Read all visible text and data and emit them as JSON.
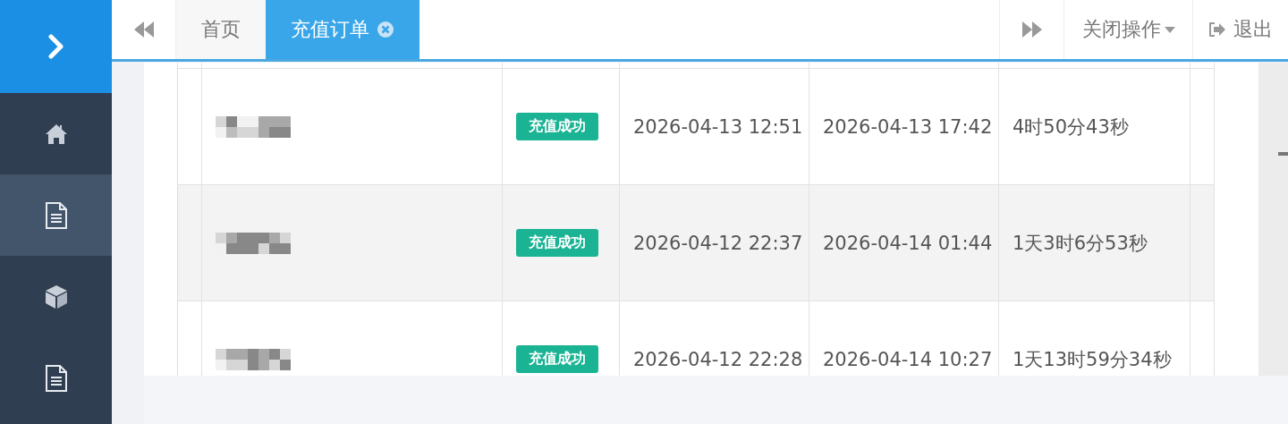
{
  "sidebar": {
    "items": [
      {
        "kind": "home",
        "selected": false
      },
      {
        "kind": "document",
        "selected": true
      },
      {
        "kind": "cube",
        "selected": false
      },
      {
        "kind": "document",
        "selected": false
      }
    ]
  },
  "tabs": [
    {
      "label": "首页",
      "selected": false,
      "closable": false
    },
    {
      "label": "充值订单",
      "selected": true,
      "closable": true
    }
  ],
  "toolbar": {
    "close_menu": "关闭操作",
    "logout": "退出"
  },
  "orders": [
    {
      "customer": {
        "kind": "redacted"
      },
      "status": "充值成功",
      "created": "2026-04-13 12:51",
      "completed": "2026-04-13 17:42",
      "duration": "4时50分43秒"
    },
    {
      "customer": {
        "kind": "redacted"
      },
      "status": "充值成功",
      "created": "2026-04-12 22:37",
      "completed": "2026-04-14 01:44",
      "duration": "1天3时6分53秒"
    },
    {
      "customer": {
        "kind": "redacted"
      },
      "status": "充值成功",
      "created": "2026-04-12 22:28",
      "completed": "2026-04-14 10:27",
      "duration": "1天13时59分34秒"
    }
  ]
}
